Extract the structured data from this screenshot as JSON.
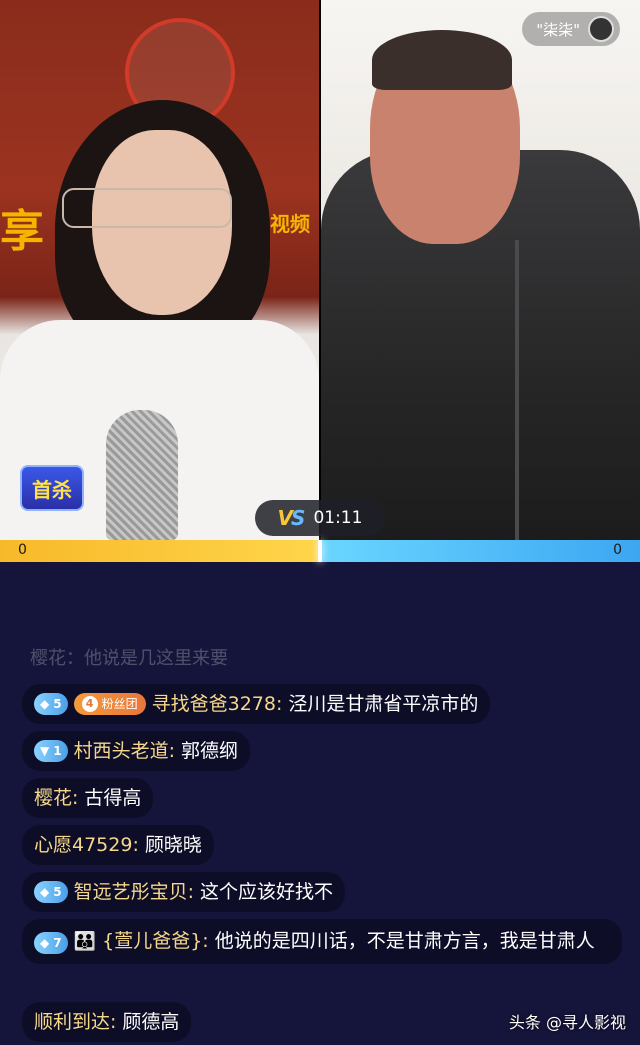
{
  "stream": {
    "host_name": "\"柒柒\"",
    "first_kill_badge": "首杀",
    "backdrop_char": "享",
    "backdrop_text": "剧视频",
    "timer": "01:11",
    "score_left": "0",
    "score_right": "0",
    "pk_left_share": 0.5
  },
  "chat": {
    "faded_line": "樱花：他说是几这里来要",
    "messages": [
      {
        "level": "5",
        "fan_level": "4",
        "fan_label": "粉丝团",
        "name": "寻找爸爸3278:",
        "text": "泾川是甘肃省平凉市的"
      },
      {
        "level": "1",
        "name": "村西头老道:",
        "text": "郭德纲"
      },
      {
        "name": "樱花:",
        "text": "古得高"
      },
      {
        "name": "心愿47529:",
        "text": "顾晓晓"
      },
      {
        "level": "5",
        "name": "智远艺彤宝贝:",
        "text": "这个应该好找不"
      },
      {
        "level": "7",
        "name": "{萱儿爸爸}:",
        "text": "他说的是四川话，不是甘肃方言，我是甘肃人"
      },
      {
        "name": "顺利到达:",
        "text": "顾德高"
      }
    ]
  },
  "watermark": "头条 @寻人影视",
  "colors": {
    "pk_left": "#f7b92a",
    "pk_right": "#3ca6f2",
    "name": "#f5d88a"
  }
}
